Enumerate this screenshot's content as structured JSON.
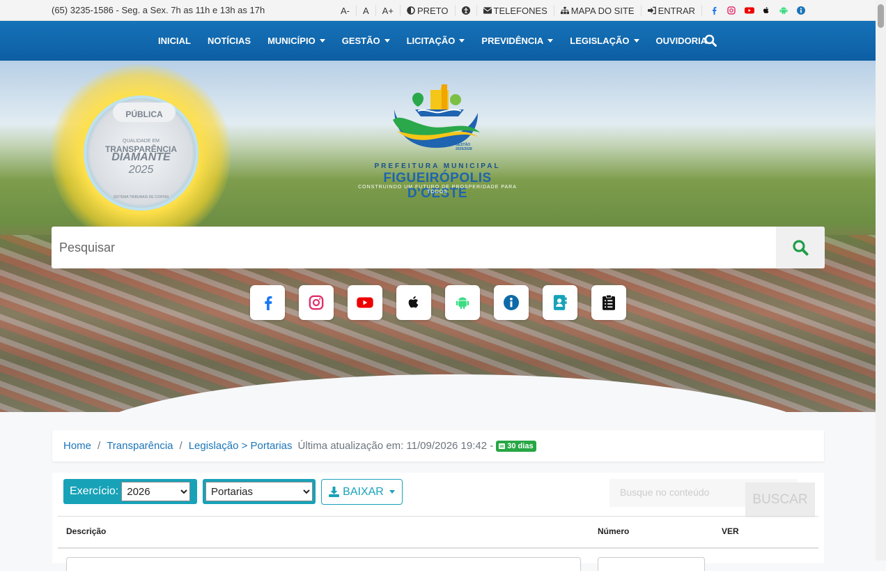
{
  "topbar": {
    "contact": "(65) 3235-1586 - Seg. a Sex. 7h as 11h e 13h as 17h",
    "font_smaller": "A-",
    "font_normal": "A",
    "font_larger": "A+",
    "contrast": "PRETO",
    "phones": "TELEFONES",
    "sitemap": "MAPA DO SITE",
    "login": "ENTRAR"
  },
  "nav": {
    "items": [
      "INICIAL",
      "NOTÍCIAS",
      "MUNICÍPIO",
      "GESTÃO",
      "LICITAÇÃO",
      "PREVIDÊNCIA",
      "LEGISLAÇÃO",
      "OUVIDORIA"
    ]
  },
  "seal": {
    "brand": "PÚBLICA",
    "quality": "QUALIDADE EM",
    "title": "TRANSPARÊNCIA",
    "level": "DIAMANTE",
    "year": "2025",
    "court": "SISTEMA TRIBUNAIS DE CONTAS"
  },
  "logo": {
    "term": "GESTÃO 2025/2028",
    "prefix": "PREFEITURA MUNICIPAL",
    "name": "FIGUEIRÓPOLIS D'OESTE",
    "slogan": "CONSTRUINDO UM FUTURO DE PROSPERIDADE PARA TODOS"
  },
  "search": {
    "placeholder": "Pesquisar"
  },
  "breadcrumb": {
    "home": "Home",
    "transparency": "Transparência",
    "section": "Legislação > Portarias",
    "updated": "Última atualização em: 11/09/2026 19:42 -",
    "badge": "30 dias"
  },
  "filters": {
    "exercise_label": "Exercício:",
    "exercise_value": "2026",
    "type_value": "Portarias",
    "download": "BAIXAR",
    "content_search_placeholder": "Busque no conteúdo",
    "search_button": "BUSCAR"
  },
  "table": {
    "headers": [
      "Descrição",
      "Número",
      "VER"
    ]
  },
  "colors": {
    "nav_blue": "#0d5ea3",
    "link_blue": "#1c75b9",
    "teal": "#17a2b8",
    "green": "#28a745",
    "search_green": "#1e9e48"
  }
}
